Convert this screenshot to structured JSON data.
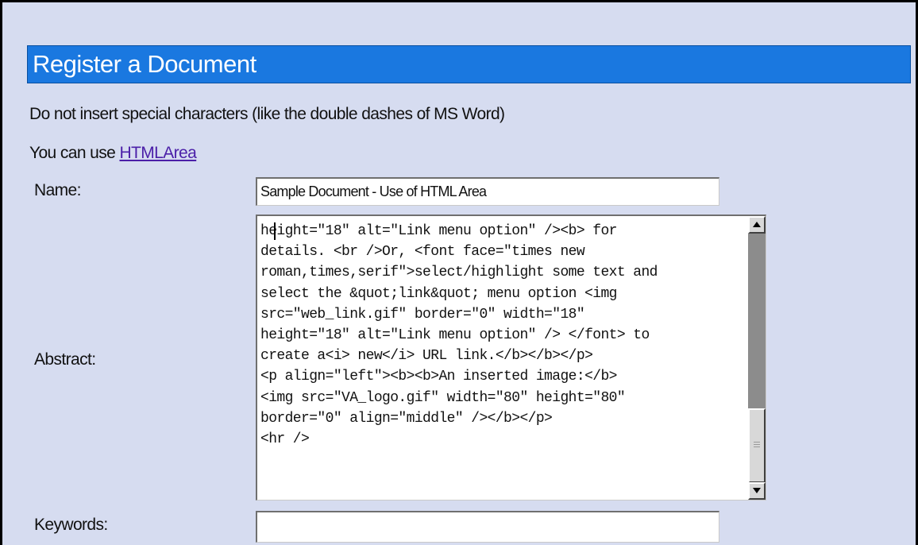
{
  "header": {
    "title": "Register a Document"
  },
  "info": {
    "line1": "Do not insert special characters (like the double dashes of MS Word)",
    "line2_prefix": "You can use ",
    "line2_link": "HTMLArea"
  },
  "form": {
    "name_label": "Name:",
    "name_value": "Sample Document - Use of HTML Area",
    "abstract_label": "Abstract:",
    "abstract_lines": [
      "height=\"18\" alt=\"Link menu option\" /><b> for",
      "details. <br />Or, <font face=\"times new",
      "roman,times,serif\">select/highlight some text and",
      "select the &quot;link&quot; menu option <img",
      "src=\"web_link.gif\" border=\"0\" width=\"18\"",
      "height=\"18\" alt=\"Link menu option\" /> </font> to",
      "create a<i> new</i> URL link.</b></b></p>",
      "<p align=\"left\"><b><b>An inserted image:</b>",
      "<img src=\"VA_logo.gif\" width=\"80\" height=\"80\"",
      "border=\"0\" align=\"middle\" /></b></p>",
      "<hr />"
    ],
    "keywords_label": "Keywords:",
    "keywords_value": ""
  },
  "colors": {
    "page_bg": "#d6dcf0",
    "header_bg": "#1a78e0",
    "link": "#4b1fa8"
  },
  "icons": [
    "scroll-up-arrow-icon",
    "scroll-down-arrow-icon"
  ]
}
